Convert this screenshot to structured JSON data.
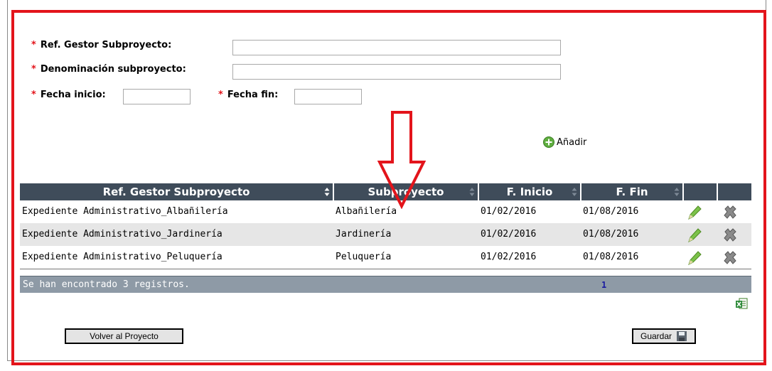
{
  "form": {
    "ref_label": "Ref. Gestor Subproyecto:",
    "denom_label": "Denominación subproyecto:",
    "fecha_inicio_label": "Fecha inicio:",
    "fecha_fin_label": "Fecha fin:",
    "required_mark": "*",
    "ref_value": "",
    "denom_value": "",
    "fecha_inicio_value": "",
    "fecha_fin_value": ""
  },
  "add_label": "Añadir",
  "table": {
    "columns": [
      "Ref. Gestor Subproyecto",
      "Subproyecto",
      "F. Inicio",
      "F. Fin",
      "",
      ""
    ],
    "rows": [
      {
        "ref": "Expediente Administrativo_Albañilería",
        "sub": "Albañilería",
        "inicio": "01/02/2016",
        "fin": "01/08/2016"
      },
      {
        "ref": "Expediente Administrativo_Jardinería",
        "sub": "Jardinería",
        "inicio": "01/02/2016",
        "fin": "01/08/2016"
      },
      {
        "ref": "Expediente Administrativo_Peluquería",
        "sub": "Peluquería",
        "inicio": "01/02/2016",
        "fin": "01/08/2016"
      }
    ],
    "footer_text": "Se han encontrado 3 registros.",
    "page": "1"
  },
  "buttons": {
    "back": "Volver al Proyecto",
    "save": "Guardar"
  },
  "icons": {
    "add": "plus-circle-icon",
    "edit": "pencil-icon",
    "delete": "x-icon",
    "excel": "excel-export-icon",
    "save": "floppy-disk-icon"
  },
  "colors": {
    "header_bg": "#3f4c5a",
    "footer_bg": "#8e9aa6",
    "highlight_red": "#e3141b",
    "row_alt": "#e6e6e6"
  }
}
